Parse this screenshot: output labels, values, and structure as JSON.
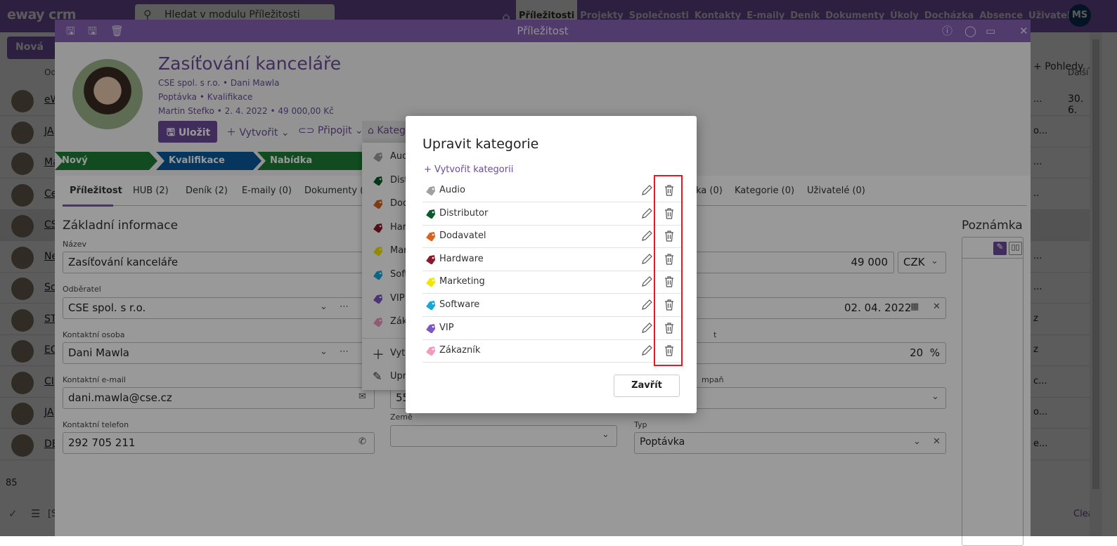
{
  "app": {
    "logo": "eway crm",
    "search_placeholder": "Hledat v modulu Příležitosti",
    "nav": [
      "Příležitosti",
      "Projekty",
      "Společnosti",
      "Kontakty",
      "E-maily",
      "Deník",
      "Dokumenty",
      "Úkoly",
      "Docházka",
      "Absence",
      "Uživatelé"
    ],
    "active_nav": "Příležitosti",
    "user_initials": "MS",
    "new_button": "Nová",
    "views_button": "Pohledy",
    "brand_color": "#7e57b5"
  },
  "list": {
    "col_from": "Od",
    "col_next": "Další k",
    "rows": [
      {
        "name": "eW",
        "right": "...",
        "date": "30. 6."
      },
      {
        "name": "JA",
        "right": "o...",
        "date": ""
      },
      {
        "name": "Ma",
        "right": "...",
        "date": ""
      },
      {
        "name": "Ce",
        "right": "..",
        "date": ""
      },
      {
        "name": "CS",
        "right": "",
        "date": "",
        "selected": true
      },
      {
        "name": "Ne",
        "right": "...",
        "date": ""
      },
      {
        "name": "Sc",
        "right": "...",
        "date": ""
      },
      {
        "name": "ST",
        "right": "z",
        "date": ""
      },
      {
        "name": "EG",
        "right": "z",
        "date": ""
      },
      {
        "name": "CI",
        "right": "c...",
        "date": ""
      },
      {
        "name": "JA",
        "right": "o...",
        "date": ""
      },
      {
        "name": "DE",
        "right": "e...",
        "date": ""
      }
    ],
    "count": "85",
    "filter_text": "[S",
    "clear_link": "Clea"
  },
  "dialog": {
    "title": "Příležitost",
    "record_title": "Zasíťování kanceláře",
    "sub1": "CSE spol. s r.o.  •  Dani Mawla",
    "sub2": "Poptávka  •  Kvalifikace",
    "sub3": "Martin Stefko  •  2. 4. 2022  •  49 000,00 Kč",
    "save": "Uložit",
    "create": "Vytvořit",
    "connect": "Připojit",
    "categories": "Kategorie",
    "stages": [
      {
        "label": "Nový",
        "color": "#1e7e34"
      },
      {
        "label": "Kvalifikace",
        "color": "#0a5a9c"
      },
      {
        "label": "Nabídka",
        "color": "#1e7e34"
      }
    ],
    "tabs": [
      "Příležitost",
      "HUB (2)",
      "Deník (2)",
      "E-maily (0)",
      "Dokumenty (0)",
      "ka (0)",
      "Kategorie (0)",
      "Uživatelé (0)"
    ],
    "section": "Základní informace",
    "fields": {
      "name_label": "Název",
      "name": "Zasíťování kanceláře",
      "customer_label": "Odběratel",
      "customer": "CSE spol. s r.o.",
      "contact_label": "Kontaktní osoba",
      "contact": "Dani Mawla",
      "email_label": "Kontaktní e-mail",
      "email": "dani.mawla@cse.cz",
      "phone_label": "Kontaktní telefon",
      "phone": "292 705 211",
      "mid_value": "55",
      "country_label": "Země",
      "country": "",
      "price": "49 000",
      "currency": "CZK",
      "date": "02. 04. 2022",
      "prob_label_fragment": "t",
      "probability": "20",
      "percent": "%",
      "campaign_label_fragment": "mpaň",
      "campaign": "",
      "type_label": "Typ",
      "type": "Poptávka"
    },
    "note_title": "Poznámka",
    "menu_create": "Vytvořit kategorii",
    "menu_edit": "Upravit kategorie"
  },
  "modal": {
    "title": "Upravit kategorie",
    "create_link": "+ Vytvořit kategorii",
    "close": "Zavřít",
    "highlight_color": "#e21b24",
    "categories": [
      {
        "name": "Audio",
        "color": "#a0a0a0"
      },
      {
        "name": "Distributor",
        "color": "#0b5a2a"
      },
      {
        "name": "Dodavatel",
        "color": "#d9621c"
      },
      {
        "name": "Hardware",
        "color": "#8b1a2b"
      },
      {
        "name": "Marketing",
        "color": "#f2e600"
      },
      {
        "name": "Software",
        "color": "#14a8dc"
      },
      {
        "name": "VIP",
        "color": "#7e57c2"
      },
      {
        "name": "Zákazník",
        "color": "#f29ac0"
      }
    ]
  }
}
